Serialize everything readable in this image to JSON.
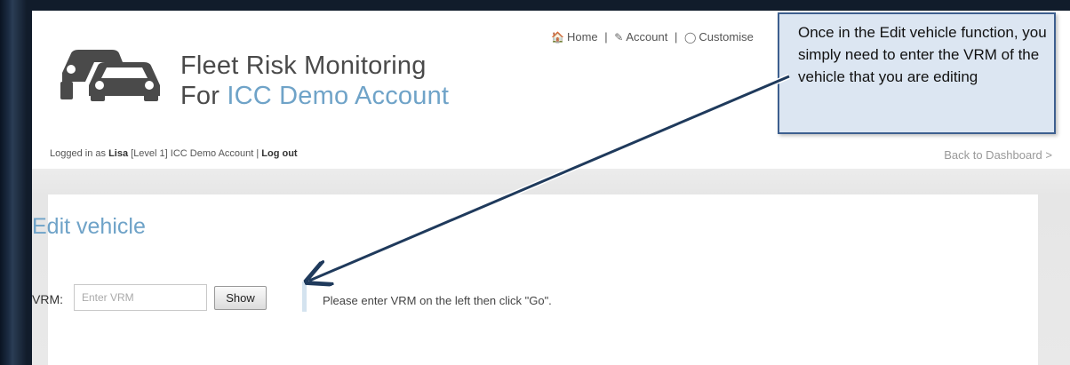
{
  "brand": {
    "line1": "Fleet Risk Monitoring",
    "line2_prefix": "For ",
    "line2_accent": "ICC Demo Account",
    "accent_color": "#6fa3c8"
  },
  "top_nav": {
    "home": "Home",
    "sep1": "|",
    "account": "Account",
    "sep2": "|",
    "customise": "Customise"
  },
  "login": {
    "prefix": "Logged in as ",
    "user": "Lisa",
    "level": " [Level 1]  ICC Demo Account  | ",
    "logout": "Log out"
  },
  "back_link": "Back to Dashboard >",
  "main": {
    "title": "Edit vehicle",
    "vrm_label": "VRM:",
    "vrm_placeholder": "Enter VRM",
    "vrm_value": "",
    "show_button": "Show",
    "info_message": "Please enter VRM on the left then click \"Go\"."
  },
  "callout": {
    "text": "Once in the Edit vehicle function, you simply need to enter the VRM of the vehicle that you are editing",
    "background": "#dce6f2",
    "border": "#3d5f8f"
  },
  "icons": {
    "home": "home-icon",
    "account": "edit-icon",
    "customise": "compass-icon",
    "logo": "cars-icon"
  }
}
